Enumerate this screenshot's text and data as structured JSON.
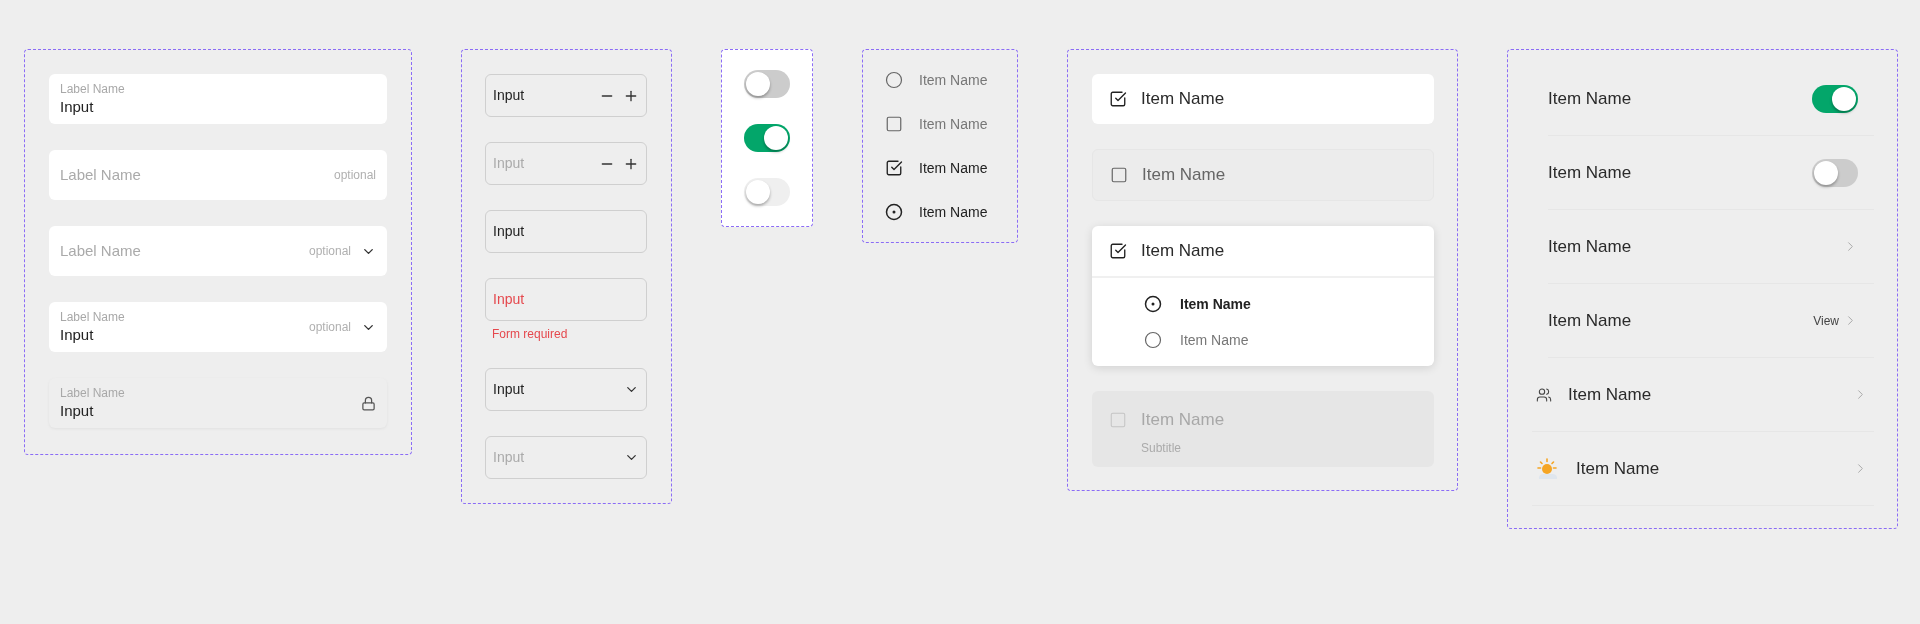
{
  "labeled_fields": [
    {
      "kind": "text",
      "label": "Label Name",
      "value": "Input",
      "disabled": false
    },
    {
      "kind": "text",
      "label": "Label Name",
      "note": "optional",
      "disabled": false
    },
    {
      "kind": "select",
      "label": "Label Name",
      "note": "optional",
      "disabled": false
    },
    {
      "kind": "select",
      "label": "Label Name",
      "value": "Input",
      "note": "optional",
      "disabled": false
    },
    {
      "kind": "text",
      "label": "Label Name",
      "value": "Input",
      "disabled": true
    }
  ],
  "inputs": [
    {
      "kind": "stepper",
      "value": "Input"
    },
    {
      "kind": "stepper",
      "placeholder": "Input"
    },
    {
      "kind": "text",
      "value": "Input"
    },
    {
      "kind": "text",
      "value": "Input",
      "error": "Form required"
    },
    {
      "kind": "select",
      "value": "Input"
    },
    {
      "kind": "select",
      "placeholder": "Input"
    }
  ],
  "toggles": [
    {
      "on": false,
      "disabled": false
    },
    {
      "on": true,
      "disabled": false
    },
    {
      "on": false,
      "disabled": true
    }
  ],
  "choices": [
    {
      "kind": "radio",
      "label": "Item Name",
      "selected": false
    },
    {
      "kind": "checkbox",
      "label": "Item Name",
      "selected": false
    },
    {
      "kind": "checkbox",
      "label": "Item Name",
      "selected": true
    },
    {
      "kind": "radio",
      "label": "Item Name",
      "selected": true
    }
  ],
  "cards": [
    {
      "label": "Item Name",
      "checked": true,
      "disabled": false,
      "expanded": false
    },
    {
      "label": "Item Name",
      "checked": false,
      "disabled": false,
      "expanded": false
    },
    {
      "label": "Item Name",
      "checked": true,
      "disabled": false,
      "expanded": true,
      "children": [
        {
          "label": "Item Name",
          "selected": true
        },
        {
          "label": "Item Name",
          "selected": false
        }
      ]
    },
    {
      "label": "Item Name",
      "subtitle": "Subtitle",
      "checked": false,
      "disabled": true,
      "expanded": false
    }
  ],
  "settings": [
    {
      "kind": "toggle",
      "label": "Item Name",
      "on": true
    },
    {
      "kind": "toggle",
      "label": "Item Name",
      "on": false
    },
    {
      "kind": "link",
      "label": "Item Name"
    },
    {
      "kind": "link",
      "label": "Item Name",
      "action": "View"
    },
    {
      "kind": "link-with-icon",
      "label": "Item Name"
    },
    {
      "kind": "link-with-thumbnail",
      "label": "Item Name"
    }
  ]
}
